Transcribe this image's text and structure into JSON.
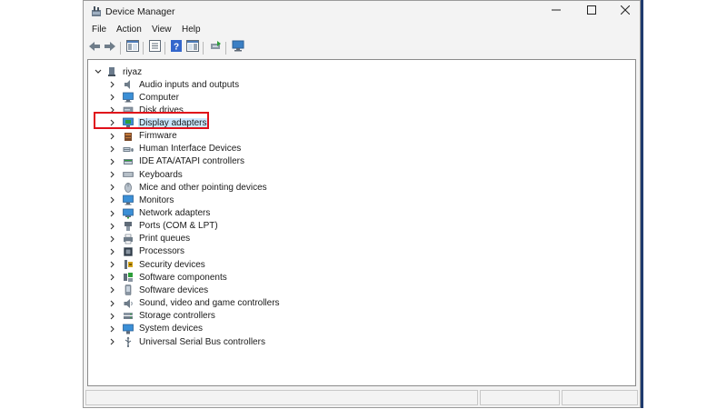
{
  "window": {
    "title": "Device Manager",
    "icons": {
      "app": "device-manager-icon",
      "minimize": "minimize-icon",
      "maximize": "maximize-icon",
      "close": "close-icon"
    }
  },
  "menubar": {
    "items": [
      {
        "label": "File"
      },
      {
        "label": "Action"
      },
      {
        "label": "View"
      },
      {
        "label": "Help"
      }
    ]
  },
  "toolbar": {
    "buttons": [
      {
        "icon": "back-arrow-icon"
      },
      {
        "icon": "forward-arrow-icon"
      },
      {
        "icon": "show-hide-console-tree-icon"
      },
      {
        "icon": "properties-icon"
      },
      {
        "icon": "help-icon"
      },
      {
        "icon": "action-pane-icon"
      },
      {
        "icon": "update-driver-icon"
      },
      {
        "icon": "scan-hardware-icon"
      }
    ]
  },
  "tree": {
    "root": {
      "label": "riyaz",
      "icon": "computer-tree-icon",
      "expanded": true
    },
    "items": [
      {
        "label": "Audio inputs and outputs",
        "icon": "speaker-icon"
      },
      {
        "label": "Computer",
        "icon": "monitor-icon"
      },
      {
        "label": "Disk drives",
        "icon": "disk-drive-icon"
      },
      {
        "label": "Display adapters",
        "icon": "display-adapter-icon",
        "selected": true
      },
      {
        "label": "Firmware",
        "icon": "firmware-icon"
      },
      {
        "label": "Human Interface Devices",
        "icon": "hid-icon"
      },
      {
        "label": "IDE ATA/ATAPI controllers",
        "icon": "ide-controller-icon"
      },
      {
        "label": "Keyboards",
        "icon": "keyboard-icon"
      },
      {
        "label": "Mice and other pointing devices",
        "icon": "mouse-icon"
      },
      {
        "label": "Monitors",
        "icon": "monitor-icon"
      },
      {
        "label": "Network adapters",
        "icon": "network-adapter-icon"
      },
      {
        "label": "Ports (COM & LPT)",
        "icon": "port-icon"
      },
      {
        "label": "Print queues",
        "icon": "printer-icon"
      },
      {
        "label": "Processors",
        "icon": "processor-icon"
      },
      {
        "label": "Security devices",
        "icon": "security-device-icon"
      },
      {
        "label": "Software components",
        "icon": "software-component-icon"
      },
      {
        "label": "Software devices",
        "icon": "software-device-icon"
      },
      {
        "label": "Sound, video and game controllers",
        "icon": "sound-controller-icon"
      },
      {
        "label": "Storage controllers",
        "icon": "storage-controller-icon"
      },
      {
        "label": "System devices",
        "icon": "system-device-icon"
      },
      {
        "label": "Universal Serial Bus controllers",
        "icon": "usb-icon"
      }
    ]
  },
  "annotation": {
    "highlight_color": "#e0101a",
    "selection_color": "#cce8ff"
  }
}
